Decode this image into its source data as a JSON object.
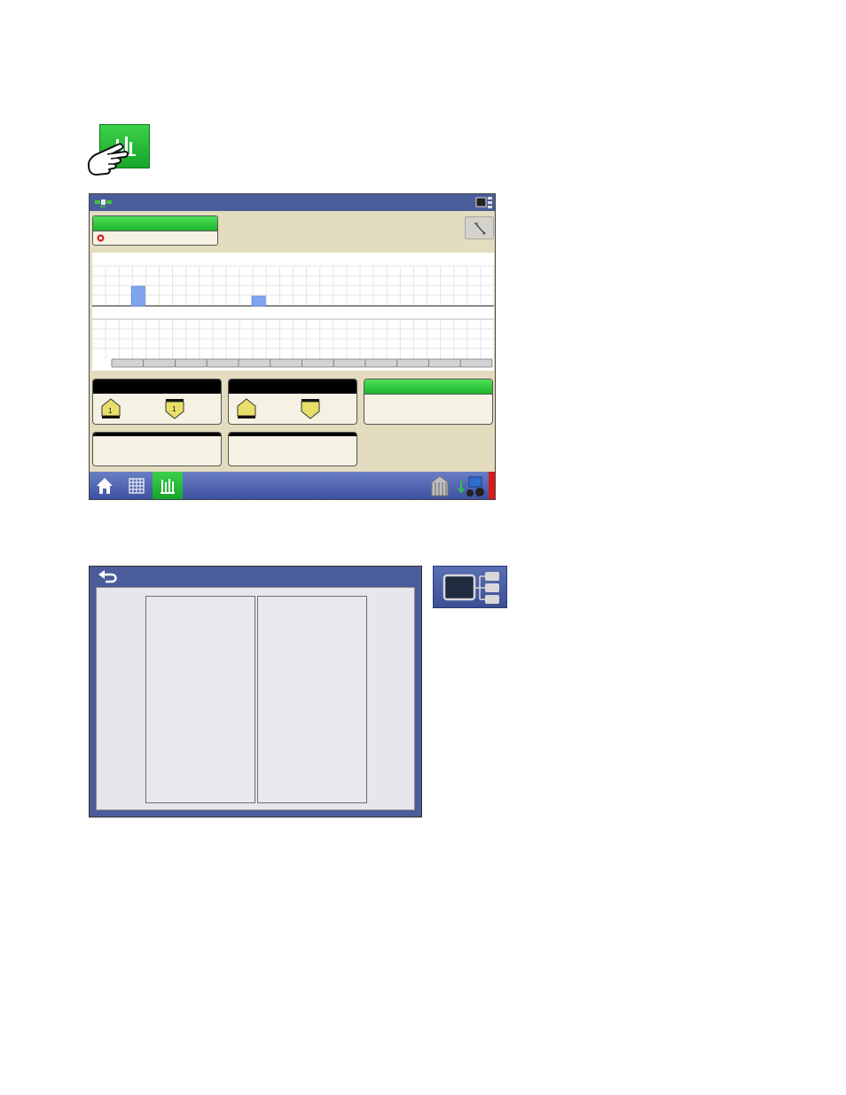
{
  "icons": {
    "diagnostic_button": "bar-chart-icon",
    "pointer": "hand-pointer-icon",
    "gps": "satellite-icon",
    "display_mode": "display-layout-icon",
    "tool": "wrench-icon",
    "home": "home-icon",
    "map": "grid-map-icon",
    "diagnostics": "bar-chart-icon",
    "field_ops": "hopper-icon",
    "vehicle": "tractor-icon",
    "alarm": "alarm-strip",
    "back": "back-arrow-icon",
    "stop": "stop-icon",
    "pentagon_up": "pentagon-up-icon",
    "pentagon_down": "pentagon-down-icon"
  },
  "indicators": {
    "box1_left_badge": "1",
    "box1_right_badge": "1"
  },
  "chart_data": {
    "type": "bar",
    "upper_values": [
      0,
      0,
      1,
      0,
      0,
      0,
      0,
      0,
      0,
      0,
      0,
      0,
      0,
      0,
      0,
      0,
      0,
      0,
      0,
      0,
      0,
      0,
      0,
      0,
      0,
      0,
      0,
      0,
      0,
      0
    ],
    "upper_values_note_free": true,
    "bar_positions": [
      2,
      11
    ],
    "bar_heights": [
      1,
      0.5
    ],
    "segments": 12,
    "grid": true
  },
  "colors": {
    "green": "#22b830",
    "title_blue": "#4a5d9a",
    "panel_tan": "#e3dcbf",
    "bar_blue": "#7ea6f0",
    "alarm_red": "#d81a1a"
  }
}
